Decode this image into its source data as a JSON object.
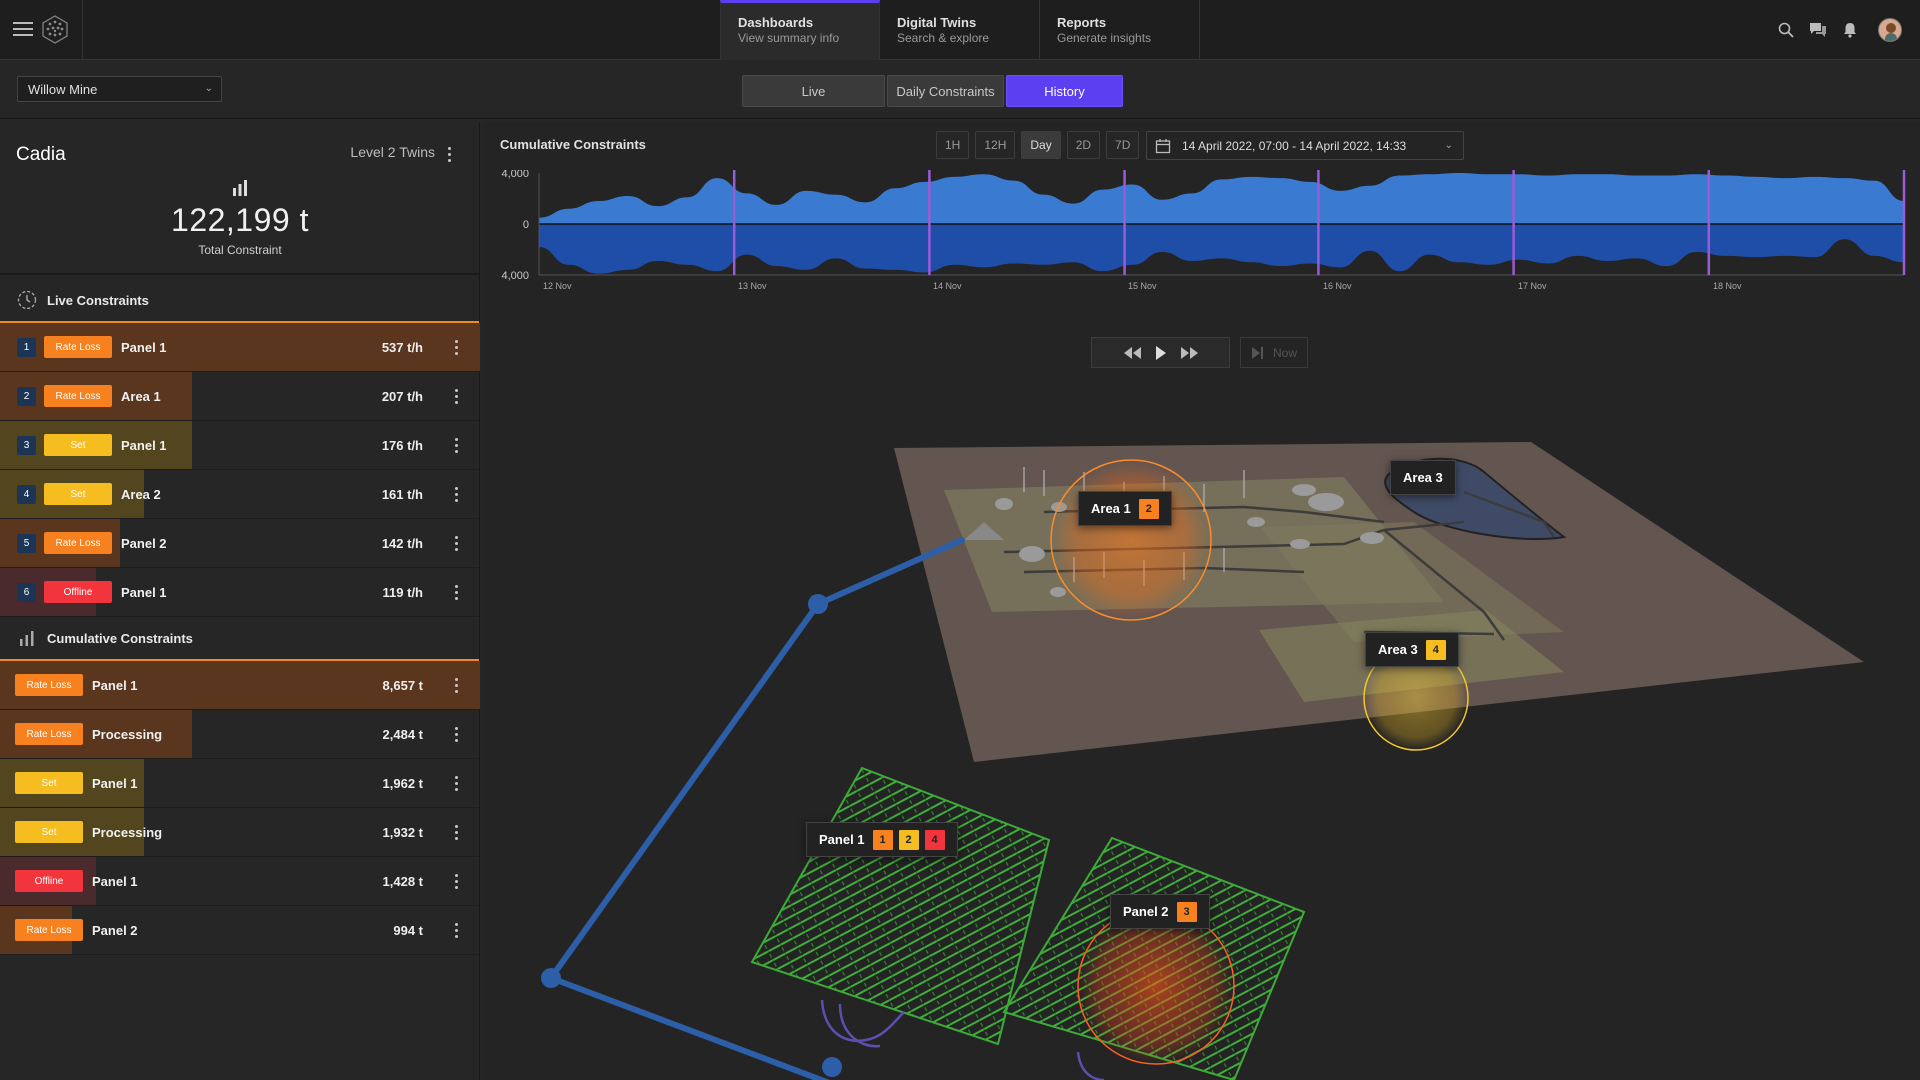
{
  "header": {
    "nav_tabs": [
      {
        "title": "Dashboards",
        "subtitle": "View summary info",
        "active": true
      },
      {
        "title": "Digital Twins",
        "subtitle": "Search & explore",
        "active": false
      },
      {
        "title": "Reports",
        "subtitle": "Generate insights",
        "active": false
      }
    ],
    "icons": [
      "search-icon",
      "chat-icon",
      "bell-icon",
      "avatar"
    ]
  },
  "site_select": {
    "value": "Willow Mine"
  },
  "view_tabs": [
    {
      "label": "Live",
      "active": false
    },
    {
      "label": "Daily Constraints",
      "active": false
    },
    {
      "label": "History",
      "active": true
    }
  ],
  "summary": {
    "title": "Cadia",
    "level": "Level 2 Twins",
    "total_value": "122,199 t",
    "total_label": "Total Constraint"
  },
  "live_constraints": {
    "title": "Live Constraints",
    "rows": [
      {
        "rank": "1",
        "type": "Rate Loss",
        "location": "Panel 1",
        "value": "537 t/h",
        "fill": 1.0
      },
      {
        "rank": "2",
        "type": "Rate Loss",
        "location": "Area 1",
        "value": "207 t/h",
        "fill": 0.4
      },
      {
        "rank": "3",
        "type": "Set",
        "location": "Panel 1",
        "value": "176 t/h",
        "fill": 0.4
      },
      {
        "rank": "4",
        "type": "Set",
        "location": "Area 2",
        "value": "161 t/h",
        "fill": 0.3
      },
      {
        "rank": "5",
        "type": "Rate Loss",
        "location": "Panel 2",
        "value": "142 t/h",
        "fill": 0.25
      },
      {
        "rank": "6",
        "type": "Offline",
        "location": "Panel 1",
        "value": "119 t/h",
        "fill": 0.2
      }
    ]
  },
  "cumulative_constraints": {
    "title": "Cumulative Constraints",
    "rows": [
      {
        "type": "Rate Loss",
        "location": "Panel 1",
        "value": "8,657 t",
        "fill": 1.0
      },
      {
        "type": "Rate Loss",
        "location": "Processing",
        "value": "2,484 t",
        "fill": 0.4
      },
      {
        "type": "Set",
        "location": "Panel 1",
        "value": "1,962 t",
        "fill": 0.3
      },
      {
        "type": "Set",
        "location": "Processing",
        "value": "1,932 t",
        "fill": 0.3
      },
      {
        "type": "Offline",
        "location": "Panel 1",
        "value": "1,428 t",
        "fill": 0.2
      },
      {
        "type": "Rate Loss",
        "location": "Panel 2",
        "value": "994 t",
        "fill": 0.15
      }
    ]
  },
  "type_colors": {
    "Rate Loss": "#f7811e",
    "Set": "#f5bd1f",
    "Offline": "#f2353d"
  },
  "row_tints": {
    "Rate Loss": "#5a361e",
    "Set": "#53461e",
    "Offline": "#4a2a2c"
  },
  "chart": {
    "title": "Cumulative Constraints",
    "range_buttons": [
      {
        "label": "1H",
        "active": false
      },
      {
        "label": "12H",
        "active": false
      },
      {
        "label": "Day",
        "active": true
      },
      {
        "label": "2D",
        "active": false
      },
      {
        "label": "7D",
        "active": false
      }
    ],
    "date_range": "14 April 2022, 07:00 - 14 April 2022,  14:33",
    "now_label": "Now"
  },
  "chart_data": {
    "type": "area",
    "y_ticks": [
      "4,000",
      "0",
      "4,000"
    ],
    "ylim": [
      -4000,
      4000
    ],
    "x_ticks": [
      "12 Nov",
      "13 Nov",
      "14 Nov",
      "15 Nov",
      "16 Nov",
      "17 Nov",
      "18 Nov"
    ],
    "series": [
      {
        "values": [
          500,
          1200,
          1800,
          2200,
          1400,
          2100,
          3600,
          2400,
          1500,
          2600,
          2300,
          1700,
          2800,
          3300,
          3700,
          3900,
          3400,
          2300,
          1600,
          2700,
          3100,
          1900,
          2400,
          3500,
          3700,
          3600,
          3300,
          2600,
          3000,
          3800,
          3900,
          4000,
          3900,
          3900,
          3800,
          3900,
          3900,
          3800,
          3800,
          3900,
          3800,
          3700,
          3600,
          3700,
          3600,
          3400,
          1800
        ],
        "color": "#3a7ad0"
      },
      {
        "values": [
          -1800,
          -3200,
          -3900,
          -3600,
          -2900,
          -3200,
          -3700,
          -2400,
          -3300,
          -3600,
          -2700,
          -3500,
          -3600,
          -3800,
          -3200,
          -3400,
          -3100,
          -3200,
          -3000,
          -3700,
          -3200,
          -2200,
          -2900,
          -2700,
          -3000,
          -3300,
          -3100,
          -3400,
          -2100,
          -3700,
          -2400,
          -3000,
          -3200,
          -2800,
          -3100,
          -2500,
          -2900,
          -2700,
          -3300,
          -2200,
          -2500,
          -2600,
          -2500,
          -2600,
          -1200,
          -2500,
          -3000
        ],
        "color": "#1f4ea8"
      }
    ],
    "markers": [
      0.143,
      0.286,
      0.429,
      0.571,
      0.714,
      0.857,
      1.0
    ],
    "grid": false,
    "legend": "none"
  },
  "scene": {
    "callouts": [
      {
        "label": "Area 1",
        "badges": [
          {
            "text": "2",
            "color": "#f7811e"
          }
        ]
      },
      {
        "label": "Area 3",
        "badges": []
      },
      {
        "label": "Area 3",
        "badges": [
          {
            "text": "4",
            "color": "#f5bd1f"
          }
        ]
      },
      {
        "label": "Panel 1",
        "badges": [
          {
            "text": "1",
            "color": "#f7811e"
          },
          {
            "text": "2",
            "color": "#f5bd1f"
          },
          {
            "text": "4",
            "color": "#f2353d"
          }
        ]
      },
      {
        "label": "Panel 2",
        "badges": [
          {
            "text": "3",
            "color": "#f7811e"
          }
        ]
      }
    ]
  }
}
